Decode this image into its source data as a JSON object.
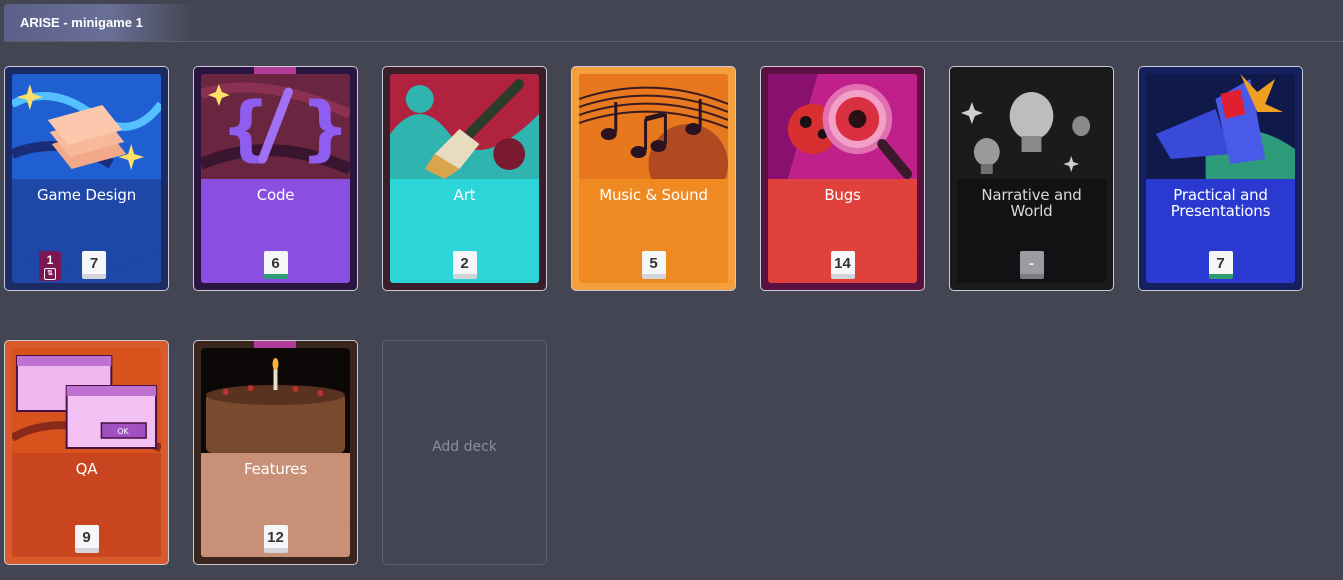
{
  "header": {
    "tab_title": "ARISE - minigame 1"
  },
  "decks": [
    {
      "name": "Game Design",
      "count": "7",
      "badge": "1",
      "band_color": "#1e47a8",
      "text_color": "#ffffff",
      "frame": "#1c2b63"
    },
    {
      "name": "Code",
      "count": "6",
      "band_color": "#8a4fe0",
      "text_color": "#ffffff",
      "frame": "#2a1540"
    },
    {
      "name": "Art",
      "count": "2",
      "band_color": "#2cd6d8",
      "text_color": "#ffffff",
      "frame": "#3a1f2a"
    },
    {
      "name": "Music & Sound",
      "count": "5",
      "band_color": "#ef8a22",
      "text_color": "#ffffff",
      "frame": "#f3a03c"
    },
    {
      "name": "Bugs",
      "count": "14",
      "band_color": "#e0413c",
      "text_color": "#ffffff",
      "frame": "#5a1040"
    },
    {
      "name": "Narrative and World",
      "count": "-",
      "band_color": "#121214",
      "text_color": "#d9d9d9",
      "frame": "#1a1a1c"
    },
    {
      "name": "Practical and Presentations",
      "count": "7",
      "band_color": "#2a3ad0",
      "text_color": "#ffffff",
      "frame": "#15205e"
    },
    {
      "name": "QA",
      "count": "9",
      "band_color": "#c9451f",
      "text_color": "#ffffff",
      "frame": "#d95a2a"
    },
    {
      "name": "Features",
      "count": "12",
      "band_color": "#c79077",
      "text_color": "#ffffff",
      "frame": "#3a261c"
    }
  ],
  "add_deck": {
    "label": "Add deck"
  },
  "icons": [
    "layers-icon",
    "code-brackets-icon",
    "paintbrush-icon",
    "music-notes-icon",
    "bug-magnifier-icon",
    "lightbulb-icon",
    "megaphone-icon",
    "windows-ok-icon",
    "cake-icon",
    "card-flip-icon"
  ]
}
